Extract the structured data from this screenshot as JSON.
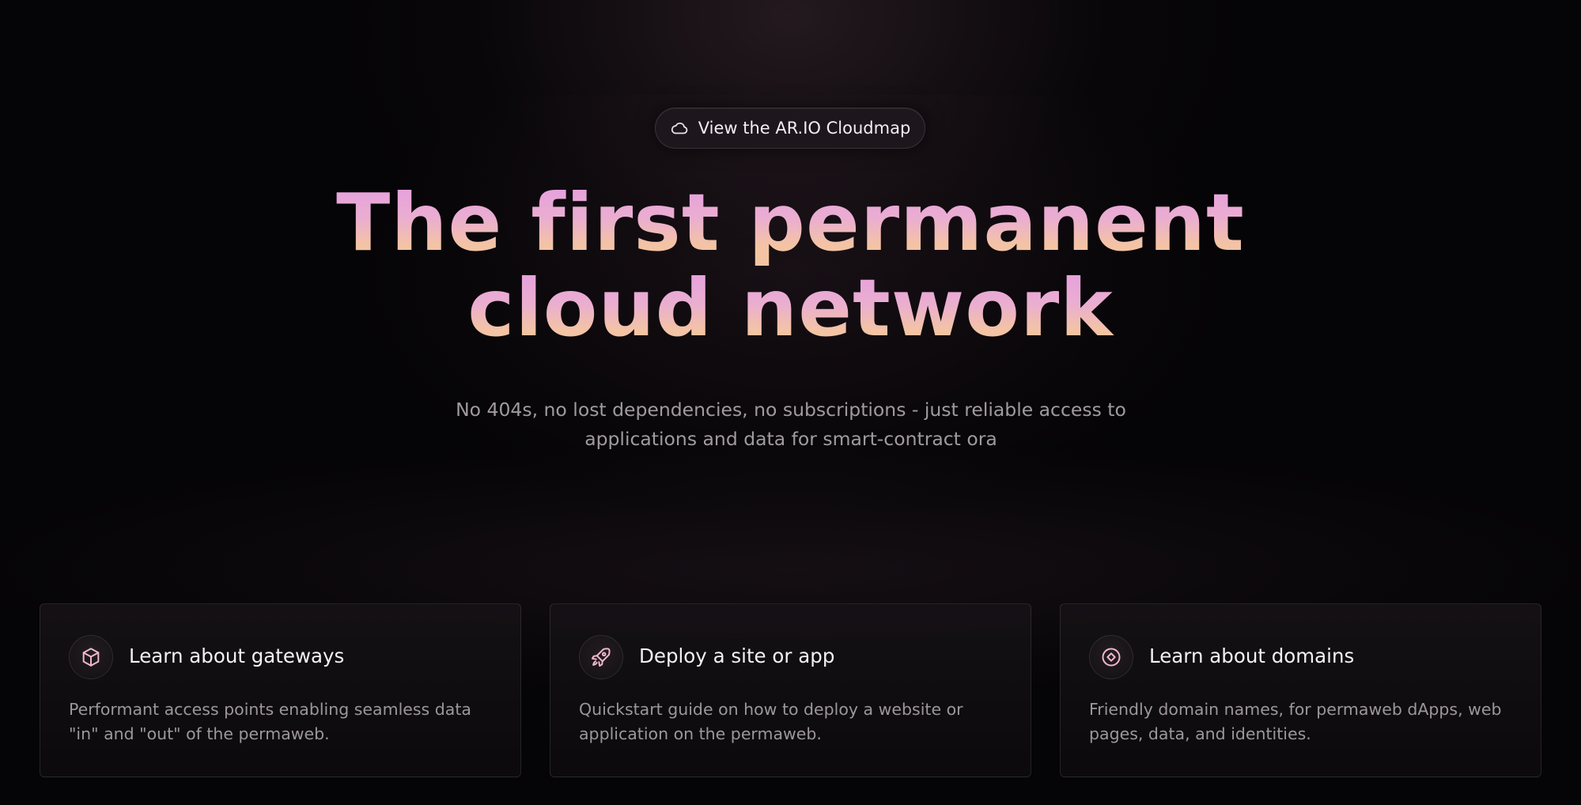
{
  "hero": {
    "cloudmap_label": "View the AR.IO Cloudmap",
    "headline_line1": "The first permanent",
    "headline_line2": "cloud network",
    "subtitle_line1": "No 404s, no lost dependencies, no subscriptions - just reliable access to",
    "subtitle_line2": "applications and data for smart-contract ora"
  },
  "cards": [
    {
      "icon": "cube-icon",
      "title": "Learn about gateways",
      "desc_line1": "Performant access points enabling seamless data",
      "desc_line2": "\"in\" and \"out\" of the permaweb."
    },
    {
      "icon": "rocket-icon",
      "title": "Deploy a site or app",
      "desc_line1": "Quickstart guide on how to deploy a website or",
      "desc_line2": "application on the permaweb."
    },
    {
      "icon": "domain-target-icon",
      "title": "Learn about domains",
      "desc_line1": "Friendly domain names, for permaweb dApps, web",
      "desc_line2": "pages, data, and identities."
    }
  ],
  "colors": {
    "background": "#050406",
    "headline_top": "#e59ee0",
    "headline_bottom": "#f5c5a1",
    "icon_accent": "#f0b8cc",
    "text_primary": "#f4f0f3",
    "text_muted": "#9d969d"
  }
}
